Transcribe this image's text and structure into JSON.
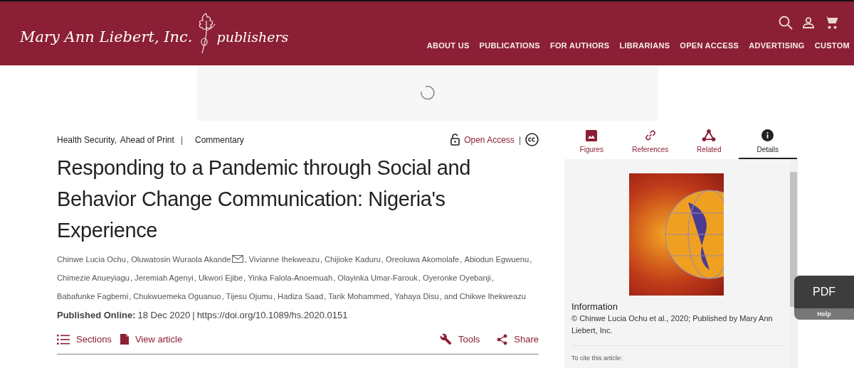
{
  "header": {
    "logo": {
      "name": "Mary Ann Liebert, Inc.",
      "tagline": "publishers"
    },
    "nav": [
      "ABOUT US",
      "PUBLICATIONS",
      "FOR AUTHORS",
      "LIBRARIANS",
      "OPEN ACCESS",
      "ADVERTISING",
      "CUSTOM"
    ]
  },
  "article": {
    "journal": "Health Security,",
    "status": "Ahead of Print",
    "separator": "|",
    "type": "Commentary",
    "access": "Open Access",
    "access_separator": "|",
    "title": "Responding to a Pandemic through Social and Behavior Change Communication: Nigeria's Experience",
    "authors": [
      {
        "name": "Chinwe Lucia Ochu",
        "email": false,
        "sep": ","
      },
      {
        "name": "Oluwatosin Wuraola Akande",
        "email": true,
        "sep": ","
      },
      {
        "name": "Vivianne Ihekweazu",
        "email": false,
        "sep": ","
      },
      {
        "name": "Chijioke Kaduru",
        "email": false,
        "sep": ","
      },
      {
        "name": "Oreoluwa Akomolafe",
        "email": false,
        "sep": ","
      },
      {
        "name": "Abiodun Egwuenu",
        "email": false,
        "sep": ","
      },
      {
        "name": "Chimezie Anueyiagu",
        "email": false,
        "sep": ","
      },
      {
        "name": "Jeremiah Agenyi",
        "email": false,
        "sep": ","
      },
      {
        "name": "Ukwori Ejibe",
        "email": false,
        "sep": ","
      },
      {
        "name": "Yinka Falola-Anoemuah",
        "email": false,
        "sep": ","
      },
      {
        "name": "Olayinka Umar-Farouk",
        "email": false,
        "sep": ","
      },
      {
        "name": "Oyeronke Oyebanji",
        "email": false,
        "sep": ","
      },
      {
        "name": "Babafunke Fagbemi",
        "email": false,
        "sep": ","
      },
      {
        "name": "Chukwuemeka Oguanuo",
        "email": false,
        "sep": ","
      },
      {
        "name": "Tijesu Ojumu",
        "email": false,
        "sep": ","
      },
      {
        "name": "Hadiza Saad",
        "email": false,
        "sep": ","
      },
      {
        "name": "Tarik Mohammed",
        "email": false,
        "sep": ","
      },
      {
        "name": "Yahaya Disu",
        "email": false,
        "sep": ", and"
      },
      {
        "name": "Chikwe Ihekweazu",
        "email": false
      }
    ],
    "published_label": "Published Online:",
    "published_date": "18 Dec 2020",
    "published_separator": "|",
    "doi": "https://doi.org/10.1089/hs.2020.0151",
    "actions": [
      {
        "kind": "sections",
        "label": "Sections"
      },
      {
        "kind": "view",
        "label": "View article"
      },
      {
        "kind": "tools",
        "label": "Tools"
      },
      {
        "kind": "share",
        "label": "Share"
      }
    ]
  },
  "sidebar": {
    "tabs": [
      {
        "kind": "figures",
        "label": "Figures",
        "selected": false
      },
      {
        "kind": "references",
        "label": "References",
        "selected": false
      },
      {
        "kind": "related",
        "label": "Related",
        "selected": false
      },
      {
        "kind": "details",
        "label": "Details",
        "selected": true
      }
    ],
    "information_heading": "Information",
    "information_text": "© Chinwe Lucia Ochu et al., 2020; Published by Mary Ann Liebert, Inc.",
    "cite_label": "To cite this article:"
  },
  "pdf_widget": {
    "label": "PDF",
    "help": "Help"
  }
}
